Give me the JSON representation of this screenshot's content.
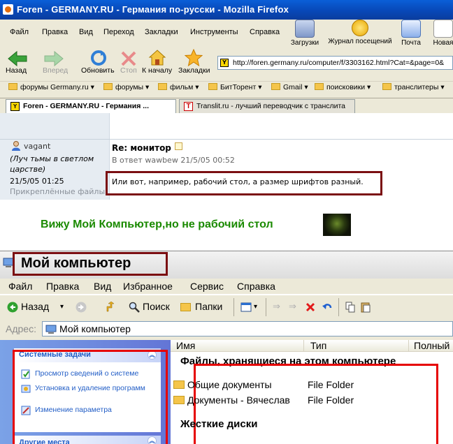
{
  "firefox": {
    "title": "Foren - GERMANY.RU - Германия по-русски - Mozilla Firefox",
    "menu": [
      "Файл",
      "Правка",
      "Вид",
      "Переход",
      "Закладки",
      "Инструменты",
      "Справка"
    ],
    "top_buttons": [
      "Загрузки",
      "Журнал посещений",
      "Почта",
      "Новая"
    ],
    "nav": {
      "back": "Назад",
      "forward": "Вперед",
      "reload": "Обновить",
      "stop": "Стоп",
      "home": "К началу",
      "bookmarks": "Закладки"
    },
    "url": "http://foren.germany.ru/computer/f/3303162.html?Cat=&page=0&",
    "bookmarks": [
      "форумы Germany.ru",
      "форумы",
      "фильм",
      "БитТорент",
      "Gmail",
      "поисковики",
      "транслитеры"
    ],
    "tabs": [
      {
        "label": "Foren - GERMANY.RU - Германия ..."
      },
      {
        "label": "Translit.ru - лучший переводчик с транслита"
      }
    ]
  },
  "forum": {
    "username": "vagant",
    "user_status": "(Луч тьмы в светлом царстве)",
    "date": "21/5/05 01:25",
    "attached": "Прикреплённые файлы",
    "post_title": "Re: монитор",
    "reply_to": "В ответ wawbew 21/5/05 00:52",
    "post_body": "Или вот, например, рабочий стол, а размер шрифтов разный."
  },
  "caption": "Вижу Мой Компьютер,но не рабочий стол",
  "explorer": {
    "title": "Мой компьютер",
    "menu": [
      "Файл",
      "Правка",
      "Вид",
      "Избранное",
      "Сервис",
      "Справка"
    ],
    "toolbar": {
      "back": "Назад",
      "search": "Поиск",
      "folders": "Папки"
    },
    "address_label": "Адрес:",
    "address_value": "Мой компьютер",
    "columns": [
      "Имя",
      "Тип",
      "Полный"
    ],
    "system_tasks": {
      "header": "Системные задачи",
      "items": [
        "Просмотр сведений о системе",
        "Установка и удаление программ",
        "Изменение параметра"
      ]
    },
    "other_places": {
      "header": "Другие места"
    },
    "group_files": "Файлы, хранящиеся на этом компьютере",
    "files": [
      {
        "name": "Общие документы",
        "type": "File Folder"
      },
      {
        "name": "Документы - Вячеслав",
        "type": "File Folder"
      }
    ],
    "group_drives": "Жесткие диски"
  },
  "colors": {
    "highlight_box": "#7b0f12",
    "red_box": "#e60000",
    "caption_green": "#1a8a00"
  }
}
